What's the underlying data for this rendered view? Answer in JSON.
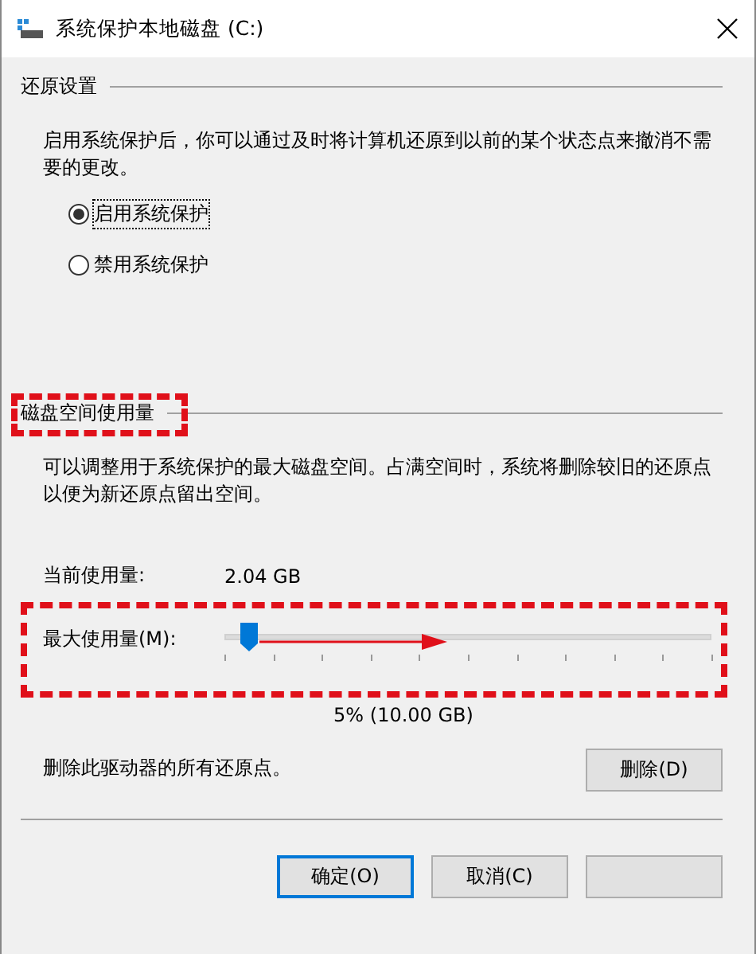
{
  "window": {
    "title": "系统保护本地磁盘 (C:)"
  },
  "restore_settings": {
    "heading": "还原设置",
    "description": "启用系统保护后，你可以通过及时将计算机还原到以前的某个状态点来撤消不需要的更改。",
    "options": [
      {
        "label": "启用系统保护",
        "selected": true
      },
      {
        "label": "禁用系统保护",
        "selected": false
      }
    ]
  },
  "disk_usage": {
    "heading": "磁盘空间使用量",
    "description": "可以调整用于系统保护的最大磁盘空间。占满空间时，系统将删除较旧的还原点以便为新还原点留出空间。",
    "current_label": "当前使用量:",
    "current_value": "2.04 GB",
    "max_slider": {
      "label": "最大使用量(M):",
      "level": 0.05,
      "reading": "5% (10.00 GB)"
    },
    "delete_text": "删除此驱动器的所有还原点。",
    "delete_button": "删除(D)"
  },
  "buttons": [
    {
      "label": "确定(O)",
      "default": true
    },
    {
      "label": "取消(C)",
      "default": false
    },
    {
      "default": false
    }
  ]
}
